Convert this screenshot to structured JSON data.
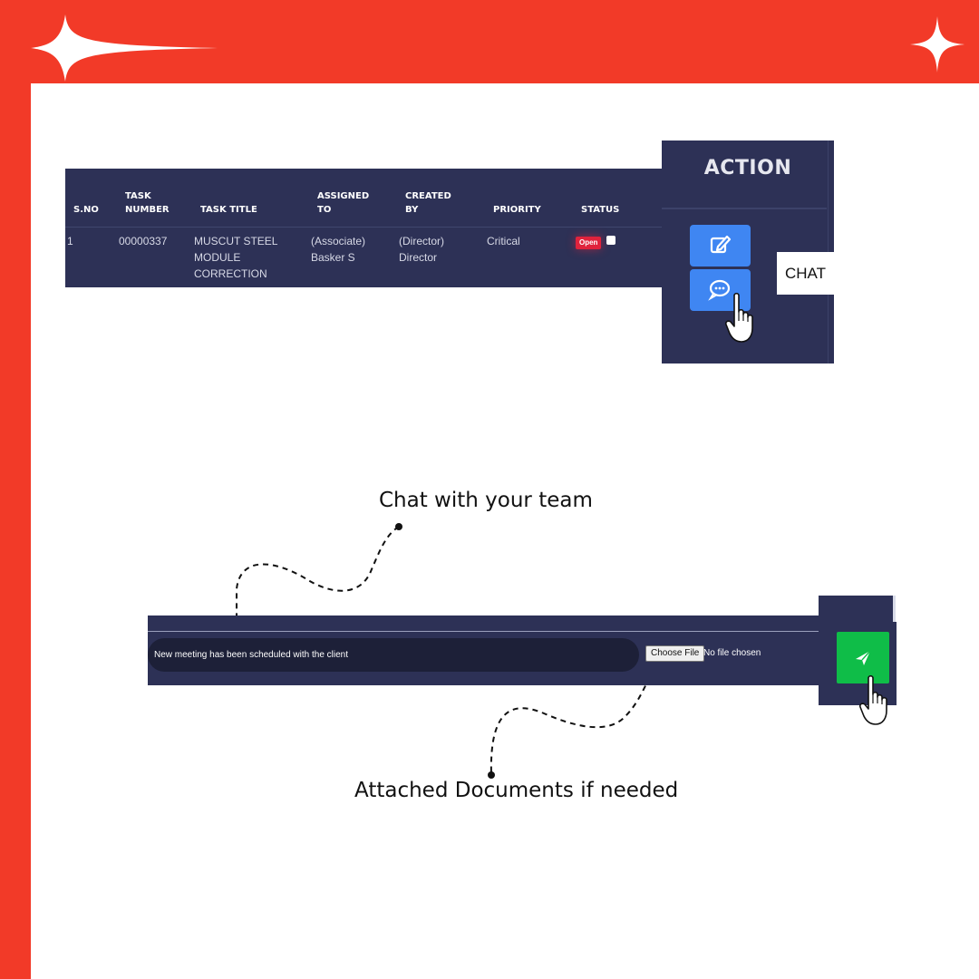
{
  "colors": {
    "frame": "#f23a28",
    "panel": "#2d3156",
    "button_blue": "#3f86f2",
    "send_green": "#0fbd48",
    "badge_red": "#e0233c"
  },
  "table": {
    "headers": {
      "sno": "S.NO",
      "task_number": "TASK\nNUMBER",
      "task_title": "TASK TITLE",
      "assigned_to": "ASSIGNED\nTO",
      "created_by": "CREATED\nBY",
      "priority": "PRIORITY",
      "status": "STATUS"
    },
    "row": {
      "sno": "1",
      "task_number": "00000337",
      "task_title": "MUSCUT STEEL\nMODULE\nCORRECTION",
      "assigned_to": "(Associate)\nBasker S",
      "created_by": "(Director)\nDirector",
      "priority": "Critical",
      "status": "Open"
    }
  },
  "action": {
    "header": "ACTION",
    "edit_icon": "edit-icon",
    "chat_icon": "chat-bubble-icon",
    "chat_label": "CHAT"
  },
  "annotations": {
    "chat_note": "Chat with your team",
    "attach_note": "Attached Documents if needed"
  },
  "chat_bar": {
    "message": "New meeting has been scheduled with the client",
    "choose_file": "Choose File",
    "file_status": "No file chosen",
    "send_icon": "send-icon"
  }
}
